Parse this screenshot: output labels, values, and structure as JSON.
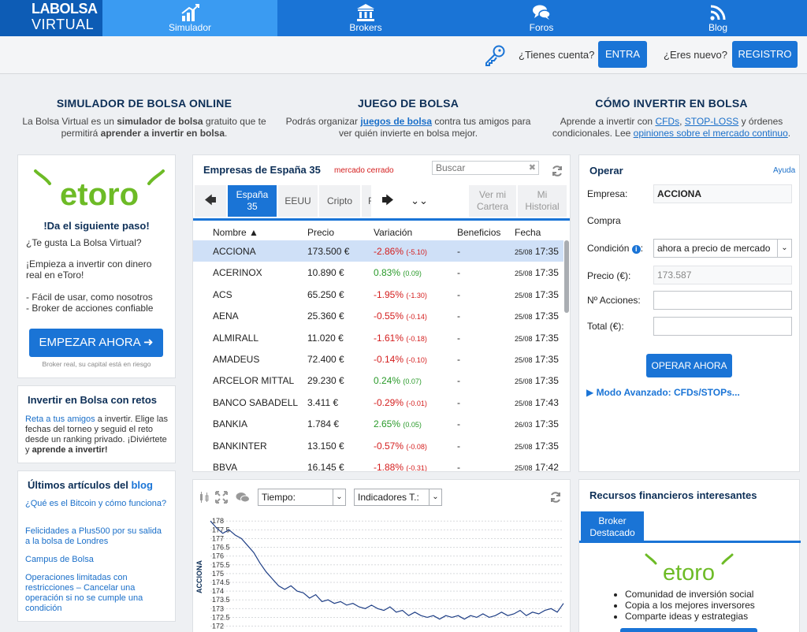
{
  "nav": {
    "logo_line1": "LABOLSA",
    "logo_line2": "VIRTUAL",
    "items": [
      {
        "label": "Simulador",
        "icon": "chart-icon"
      },
      {
        "label": "Brokers",
        "icon": "bank-icon"
      },
      {
        "label": "Foros",
        "icon": "chat-icon"
      },
      {
        "label": "Blog",
        "icon": "rss-icon"
      }
    ]
  },
  "account": {
    "have_account": "¿Tienes cuenta?",
    "login": "ENTRA",
    "new_user": "¿Eres nuevo?",
    "register": "REGISTRO"
  },
  "intro": {
    "col1": {
      "title": "SIMULADOR DE BOLSA ONLINE",
      "t1": "La Bolsa Virtual es un ",
      "b1": "simulador de bolsa",
      "t2": " gratuito que te permitirá ",
      "b2": "aprender a invertir en bolsa",
      "t3": "."
    },
    "col2": {
      "title": "JUEGO DE BOLSA",
      "t1": "Podrás organizar ",
      "link": "juegos de bolsa",
      "t2": " contra tus amigos para ver quién invierte en bolsa mejor."
    },
    "col3": {
      "title": "CÓMO INVERTIR EN BOLSA",
      "t1": "Aprende a invertir con ",
      "l1": "CFDs",
      "t2": ", ",
      "l2": "STOP-LOSS",
      "t3": " y órdenes condicionales. Lee ",
      "l3": "opiniones sobre el mercado continuo",
      "t4": "."
    }
  },
  "etoro": {
    "logo": "etoro",
    "headline": "!Da el siguiente paso!",
    "q": "¿Te gusta La Bolsa Virtual?",
    "p1": "¡Empieza a invertir con dinero real en eToro!",
    "b1": "- Fácil de usar, como nosotros",
    "b2": "- Broker de acciones confiable",
    "cta": "EMPEZAR AHORA ➜",
    "disclaimer": "Broker real, su capital está en riesgo"
  },
  "retos": {
    "title": "Invertir en Bolsa con retos",
    "link": "Reta a tus amigos",
    "t1": " a invertir. Elige las fechas del torneo y seguid el reto desde un ranking privado. ¡Diviértete y ",
    "bold": "aprende a invertir!"
  },
  "articles": {
    "title_a": "Últimos artículos del ",
    "title_b": "blog",
    "items": [
      "¿Qué es el Bitcoin y cómo funciona?",
      "Felicidades a Plus500 por su salida a la bolsa de Londres",
      "Campus de Bolsa",
      "Operaciones limitadas con restricciones – Cancelar una operación si no se cumple una condición"
    ]
  },
  "market": {
    "title": "Empresas de España 35",
    "status": "mercado cerrado",
    "search_placeholder": "Buscar",
    "tabs": [
      "España 35",
      "EEUU",
      "Cripto",
      "F"
    ],
    "right_tabs": [
      {
        "l1": "Ver mi",
        "l2": "Cartera"
      },
      {
        "l1": "Mi",
        "l2": "Historial"
      }
    ],
    "active_l1": "España",
    "active_l2": "35",
    "headers": {
      "name": "Nombre ▲",
      "price": "Precio",
      "var": "Variación",
      "ben": "Beneficios",
      "date": "Fecha"
    },
    "rows": [
      {
        "name": "ACCIONA",
        "price": "173.500 €",
        "var": "-2.86%",
        "chg": "(-5.10)",
        "dir": "neg",
        "ben": "-",
        "d": "25/08",
        "t": "17:35"
      },
      {
        "name": "ACERINOX",
        "price": "10.890 €",
        "var": "0.83%",
        "chg": "(0.09)",
        "dir": "pos",
        "ben": "-",
        "d": "25/08",
        "t": "17:35"
      },
      {
        "name": "ACS",
        "price": "65.250 €",
        "var": "-1.95%",
        "chg": "(-1.30)",
        "dir": "neg",
        "ben": "-",
        "d": "25/08",
        "t": "17:35"
      },
      {
        "name": "AENA",
        "price": "25.360 €",
        "var": "-0.55%",
        "chg": "(-0.14)",
        "dir": "neg",
        "ben": "-",
        "d": "25/08",
        "t": "17:35"
      },
      {
        "name": "ALMIRALL",
        "price": "11.020 €",
        "var": "-1.61%",
        "chg": "(-0.18)",
        "dir": "neg",
        "ben": "-",
        "d": "25/08",
        "t": "17:35"
      },
      {
        "name": "AMADEUS",
        "price": "72.400 €",
        "var": "-0.14%",
        "chg": "(-0.10)",
        "dir": "neg",
        "ben": "-",
        "d": "25/08",
        "t": "17:35"
      },
      {
        "name": "ARCELOR MITTAL",
        "price": "29.230 €",
        "var": "0.24%",
        "chg": "(0.07)",
        "dir": "pos",
        "ben": "-",
        "d": "25/08",
        "t": "17:35"
      },
      {
        "name": "BANCO SABADELL",
        "price": "3.411 €",
        "var": "-0.29%",
        "chg": "(-0.01)",
        "dir": "neg",
        "ben": "-",
        "d": "25/08",
        "t": "17:43"
      },
      {
        "name": "BANKIA",
        "price": "1.784 €",
        "var": "2.65%",
        "chg": "(0.05)",
        "dir": "pos",
        "ben": "-",
        "d": "26/03",
        "t": "17:35"
      },
      {
        "name": "BANKINTER",
        "price": "13.150 €",
        "var": "-0.57%",
        "chg": "(-0.08)",
        "dir": "neg",
        "ben": "-",
        "d": "25/08",
        "t": "17:35"
      },
      {
        "name": "BBVA",
        "price": "16.145 €",
        "var": "-1.88%",
        "chg": "(-0.31)",
        "dir": "neg",
        "ben": "-",
        "d": "25/08",
        "t": "17:42"
      }
    ]
  },
  "order": {
    "title": "Operar",
    "help": "Ayuda",
    "company_label": "Empresa:",
    "company": "ACCIONA",
    "type": "Compra",
    "cond_label": "Condición",
    "cond_value": "ahora a precio de mercado",
    "price_label": "Precio (€):",
    "price_value": "173.587",
    "shares_label": "Nº Acciones:",
    "total_label": "Total (€):",
    "submit": "OPERAR AHORA",
    "advanced": "▶  Modo Avanzado: CFDs/STOPs..."
  },
  "chart_ctrl": {
    "tiempo": "Tiempo:",
    "indicadores": "Indicadores T.:"
  },
  "chart_data": {
    "type": "line",
    "title": "",
    "xlabel": "",
    "ylabel": "ACCIONA",
    "ylim": [
      171.8,
      178.1
    ],
    "yticks": [
      "178",
      "177.5",
      "177",
      "176.5",
      "176",
      "175.5",
      "175",
      "174.5",
      "174",
      "173.5",
      "173",
      "172.5",
      "172"
    ],
    "values": [
      178.0,
      177.6,
      177.3,
      177.5,
      177.2,
      177.0,
      176.6,
      176.2,
      175.6,
      175.1,
      174.7,
      174.3,
      174.1,
      174.3,
      174.0,
      173.9,
      173.6,
      173.8,
      173.4,
      173.5,
      173.3,
      173.4,
      173.2,
      173.3,
      173.1,
      173.0,
      173.2,
      173.0,
      172.9,
      173.1,
      172.8,
      172.9,
      172.6,
      172.8,
      172.6,
      172.5,
      172.6,
      172.4,
      172.6,
      172.5,
      172.6,
      172.4,
      172.6,
      172.5,
      172.7,
      172.5,
      172.6,
      172.8,
      172.6,
      172.7,
      172.9,
      172.6,
      172.8,
      172.7,
      172.9,
      173.0,
      172.8,
      173.3
    ]
  },
  "resources": {
    "title": "Recursos financieros interesantes",
    "tab_l1": "Broker",
    "tab_l2": "Destacado",
    "logo": "etoro",
    "items": [
      "Comunidad de inversión social",
      "Copia a los mejores inversores",
      "Comparte ideas y estrategias"
    ]
  }
}
